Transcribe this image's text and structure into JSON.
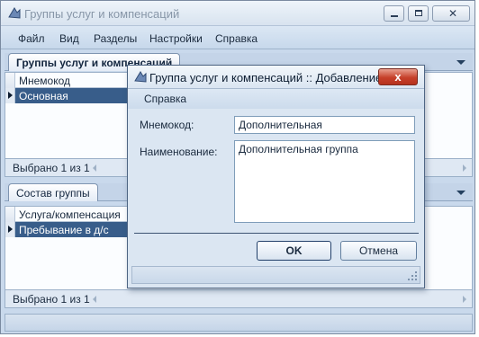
{
  "window": {
    "title": "Группы услуг и компенсаций"
  },
  "menu": [
    "Файл",
    "Вид",
    "Разделы",
    "Настройки",
    "Справка"
  ],
  "top_panel": {
    "tab": "Группы услуг и компенсаций",
    "column": "Мнемокод",
    "selected_row": "Основная",
    "footer": "Выбрано 1 из 1"
  },
  "bottom_panel": {
    "tab": "Состав группы",
    "column": "Услуга/компенсация",
    "selected_row": "Пребывание в д/с",
    "footer": "Выбрано 1 из 1"
  },
  "dialog": {
    "title": "Группа услуг и компенсаций :: Добавление",
    "menu": "Справка",
    "mnemocode_label": "Мнемокод:",
    "mnemocode_value": "Дополнительная",
    "name_label": "Наименование:",
    "name_value": "Дополнительная группа",
    "ok": "OK",
    "cancel": "Отмена",
    "close": "x"
  },
  "colors": {
    "selection": "#385d8a",
    "close_button": "#c6402a",
    "frame": "#c9d9ec"
  }
}
